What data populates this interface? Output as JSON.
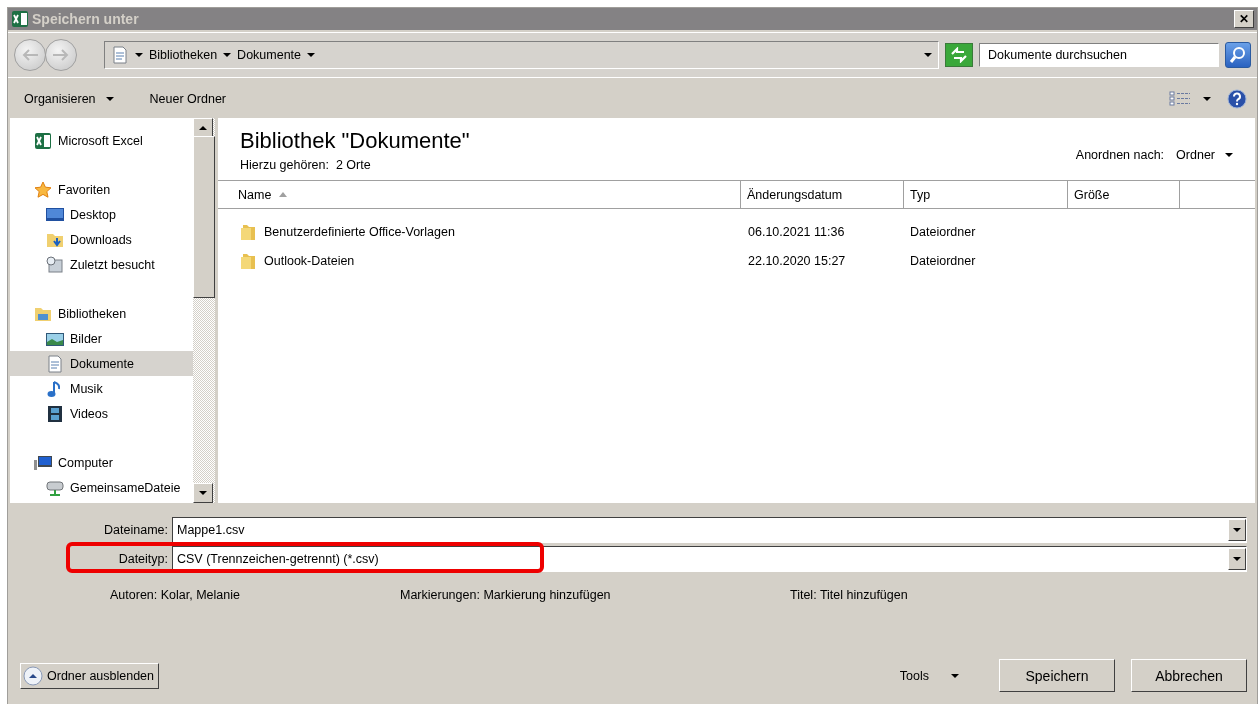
{
  "window": {
    "title": "Speichern unter",
    "close": "✕"
  },
  "address": {
    "crumbs": [
      "Bibliotheken",
      "Dokumente"
    ]
  },
  "search": {
    "placeholder": "Dokumente durchsuchen"
  },
  "toolbar": {
    "organize": "Organisieren",
    "new_folder": "Neuer Ordner"
  },
  "sidebar": {
    "items": [
      {
        "label": "Microsoft Excel",
        "kind": "excel",
        "selected": false
      },
      {
        "label": "Favoriten",
        "kind": "star",
        "selected": false,
        "children": [
          {
            "label": "Desktop",
            "kind": "desktop",
            "selected": false
          },
          {
            "label": "Downloads",
            "kind": "downloads",
            "selected": false
          },
          {
            "label": "Zuletzt besucht",
            "kind": "recent",
            "selected": false
          }
        ]
      },
      {
        "label": "Bibliotheken",
        "kind": "library",
        "selected": false,
        "children": [
          {
            "label": "Bilder",
            "kind": "pictures",
            "selected": false
          },
          {
            "label": "Dokumente",
            "kind": "document",
            "selected": true
          },
          {
            "label": "Musik",
            "kind": "music",
            "selected": false
          },
          {
            "label": "Videos",
            "kind": "video",
            "selected": false
          }
        ]
      },
      {
        "label": "Computer",
        "kind": "computer",
        "selected": false,
        "children": [
          {
            "label": "GemeinsameDateie",
            "kind": "network",
            "selected": false
          }
        ]
      }
    ]
  },
  "library": {
    "title": "Bibliothek \"Dokumente\"",
    "includes_label": "Hierzu gehören:",
    "includes_value": "2 Orte",
    "arrange_label": "Anordnen nach:",
    "arrange_value": "Ordner"
  },
  "table": {
    "columns": [
      {
        "label": "Name",
        "sorted": true
      },
      {
        "label": "Änderungsdatum",
        "sorted": false
      },
      {
        "label": "Typ",
        "sorted": false
      },
      {
        "label": "Größe",
        "sorted": false
      }
    ],
    "rows": [
      {
        "name": "Benutzerdefinierte Office-Vorlagen",
        "date": "06.10.2021 11:36",
        "type": "Dateiordner"
      },
      {
        "name": "Outlook-Dateien",
        "date": "22.10.2020 15:27",
        "type": "Dateiordner"
      }
    ]
  },
  "fields": [
    {
      "label": "Dateiname:",
      "value": "Mappe1.csv",
      "highlighted": false
    },
    {
      "label": "Dateityp:",
      "value": "CSV (Trennzeichen-getrennt) (*.csv)",
      "highlighted": true
    }
  ],
  "metadata": [
    {
      "label": "Autoren:",
      "value": "Kolar, Melanie"
    },
    {
      "label": "Markierungen:",
      "value": "Markierung hinzufügen"
    },
    {
      "label": "Titel:",
      "value": "Titel hinzufügen"
    }
  ],
  "footer": {
    "hide_folders": "Ordner ausblenden",
    "tools": "Tools",
    "save": "Speichern",
    "cancel": "Abbrechen"
  }
}
